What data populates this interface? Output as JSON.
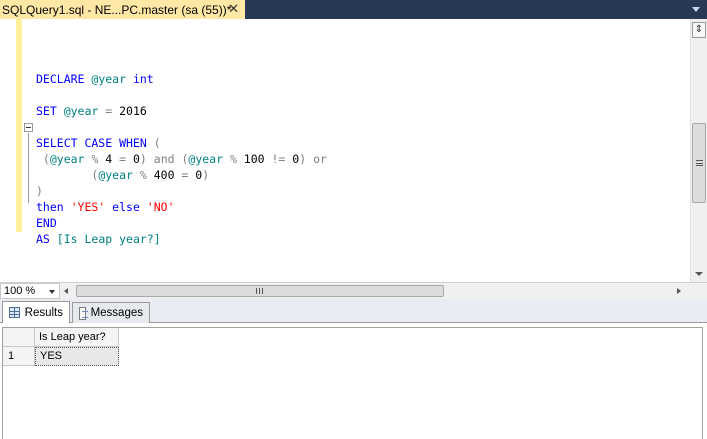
{
  "document_tab": {
    "title": "SQLQuery1.sql - NE...PC.master (sa (55))*",
    "close_glyph": "✕"
  },
  "editor": {
    "lines": [
      [],
      [
        {
          "t": "DECLARE ",
          "c": "kw"
        },
        {
          "t": "@year ",
          "c": "var"
        },
        {
          "t": "int",
          "c": "kw"
        }
      ],
      [],
      [
        {
          "t": "SET ",
          "c": "kw"
        },
        {
          "t": "@year ",
          "c": "var"
        },
        {
          "t": "= ",
          "c": "gr"
        },
        {
          "t": "2016",
          "c": "num"
        }
      ],
      [],
      [
        {
          "t": "SELECT CASE WHEN ",
          "c": "kw"
        },
        {
          "t": "(",
          "c": "gr"
        }
      ],
      [
        {
          "t": " (",
          "c": "gr"
        },
        {
          "t": "@year ",
          "c": "var"
        },
        {
          "t": "% ",
          "c": "gr"
        },
        {
          "t": "4 ",
          "c": "num"
        },
        {
          "t": "= ",
          "c": "gr"
        },
        {
          "t": "0",
          "c": "num"
        },
        {
          "t": ") and (",
          "c": "gr"
        },
        {
          "t": "@year ",
          "c": "var"
        },
        {
          "t": "% ",
          "c": "gr"
        },
        {
          "t": "100 ",
          "c": "num"
        },
        {
          "t": "!= ",
          "c": "gr"
        },
        {
          "t": "0",
          "c": "num"
        },
        {
          "t": ") or",
          "c": "gr"
        }
      ],
      [
        {
          "t": "        (",
          "c": "gr"
        },
        {
          "t": "@year ",
          "c": "var"
        },
        {
          "t": "% ",
          "c": "gr"
        },
        {
          "t": "400 ",
          "c": "num"
        },
        {
          "t": "= ",
          "c": "gr"
        },
        {
          "t": "0",
          "c": "num"
        },
        {
          "t": ")",
          "c": "gr"
        }
      ],
      [
        {
          "t": ")",
          "c": "gr"
        }
      ],
      [
        {
          "t": "then ",
          "c": "kw"
        },
        {
          "t": "'YES' ",
          "c": "str"
        },
        {
          "t": "else ",
          "c": "kw"
        },
        {
          "t": "'NO'",
          "c": "str"
        }
      ],
      [
        {
          "t": "END",
          "c": "kw"
        }
      ],
      [
        {
          "t": "AS ",
          "c": "kw"
        },
        {
          "t": "[Is Leap year?]",
          "c": "var"
        }
      ]
    ]
  },
  "zoom": {
    "value": "100 %"
  },
  "result_tabs": [
    {
      "label": "Results",
      "icon": "grid-icon",
      "active": true
    },
    {
      "label": "Messages",
      "icon": "messages-icon",
      "active": false
    }
  ],
  "results_grid": {
    "columns": [
      "Is Leap year?"
    ],
    "rows": [
      {
        "num": "1",
        "cells": [
          "YES"
        ]
      }
    ]
  },
  "colors": {
    "keyword": "#0000ff",
    "variable": "#008080",
    "operator": "#808080",
    "string": "#ff0000",
    "tab_active": "#ffe8a6",
    "title_bar": "#293955"
  }
}
